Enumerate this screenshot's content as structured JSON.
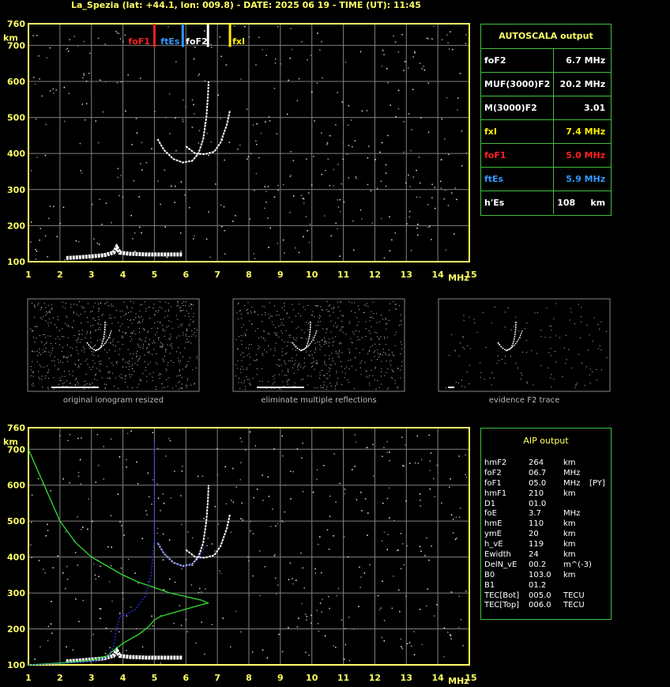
{
  "header": {
    "title": "La_Spezia (lat: +44.1, lon: 009.8) - DATE: 2025 06 19 - TIME (UT): 11:45"
  },
  "colors": {
    "frame": "#ffff66",
    "grid": "#808080",
    "panel_border": "#3fbf3f",
    "foF1": "#ff2020",
    "ftEs": "#3399ff",
    "foF2": "#ffffff",
    "fxI": "#ffee00",
    "profile": "#33dd33",
    "model_trace": "#2233ff"
  },
  "autoscala": {
    "title": "AUTOSCALA output",
    "rows": [
      {
        "label": "foF2",
        "value": "6.7 MHz",
        "color": "#ffffff"
      },
      {
        "label": "MUF(3000)F2",
        "value": "20.2 MHz",
        "color": "#ffffff"
      },
      {
        "label": "M(3000)F2",
        "value": "3.01",
        "color": "#ffffff"
      },
      {
        "label": "fxI",
        "value": "7.4 MHz",
        "color": "#ffee00"
      },
      {
        "label": "foF1",
        "value": "5.0 MHz",
        "color": "#ff2020"
      },
      {
        "label": "ftEs",
        "value": "5.9 MHz",
        "color": "#3399ff"
      },
      {
        "label": "h'Es",
        "value": "108     km",
        "color": "#ffffff"
      }
    ]
  },
  "aip": {
    "title": "AIP output",
    "rows": [
      [
        "hmF2",
        "264",
        "km",
        ""
      ],
      [
        "foF2",
        "06.7",
        "MHz",
        ""
      ],
      [
        "foF1",
        "05.0",
        "MHz",
        "[PY]"
      ],
      [
        "hmF1",
        "210",
        "km",
        ""
      ],
      [
        "D1",
        "01.0",
        "",
        ""
      ],
      [
        "foE",
        "3.7",
        "MHz",
        ""
      ],
      [
        "hmE",
        "110",
        "km",
        ""
      ],
      [
        "ymE",
        "20",
        "km",
        ""
      ],
      [
        "h_vE",
        "119",
        "km",
        ""
      ],
      [
        "Ewidth",
        "24",
        "km",
        ""
      ],
      [
        "DelN_vE",
        "00.2",
        "m^(-3)",
        ""
      ],
      [
        "B0",
        "103.0",
        "km",
        ""
      ],
      [
        "B1",
        "01.2",
        "",
        ""
      ],
      [
        "TEC[Bot]",
        "005.0",
        "TECU",
        ""
      ],
      [
        "TEC[Top]",
        "006.0",
        "TECU",
        ""
      ]
    ]
  },
  "thumbnails": [
    {
      "caption": "original ionogram resized"
    },
    {
      "caption": "eliminate multiple reflections"
    },
    {
      "caption": "evidence F2 trace"
    }
  ],
  "chart_data": [
    {
      "type": "scatter",
      "xlabel": "MHz",
      "ylabel": "km",
      "xlim": [
        1,
        15
      ],
      "ylim": [
        100,
        760
      ],
      "x_ticks": [
        1,
        2,
        3,
        4,
        5,
        6,
        7,
        8,
        9,
        10,
        11,
        12,
        13,
        14,
        15
      ],
      "y_ticks": [
        100,
        200,
        300,
        400,
        500,
        600,
        700,
        760
      ],
      "markers": [
        {
          "name": "foF1",
          "x": 5.0,
          "color": "#ff2020"
        },
        {
          "name": "ftEs",
          "x": 5.9,
          "color": "#3399ff"
        },
        {
          "name": "foF2",
          "x": 6.7,
          "color": "#ffffff"
        },
        {
          "name": "fxI",
          "x": 7.4,
          "color": "#ffee00"
        }
      ],
      "traces": {
        "es_trace": [
          [
            2.2,
            110
          ],
          [
            2.6,
            112
          ],
          [
            3.0,
            115
          ],
          [
            3.4,
            118
          ],
          [
            3.7,
            125
          ],
          [
            3.8,
            140
          ],
          [
            3.9,
            125
          ],
          [
            4.2,
            122
          ],
          [
            4.8,
            120
          ],
          [
            5.4,
            120
          ],
          [
            5.9,
            120
          ]
        ],
        "o_trace": [
          [
            5.1,
            440
          ],
          [
            5.3,
            410
          ],
          [
            5.6,
            385
          ],
          [
            5.9,
            375
          ],
          [
            6.2,
            380
          ],
          [
            6.4,
            400
          ],
          [
            6.55,
            440
          ],
          [
            6.65,
            500
          ],
          [
            6.7,
            560
          ],
          [
            6.72,
            600
          ]
        ],
        "x_trace": [
          [
            6.0,
            420
          ],
          [
            6.3,
            400
          ],
          [
            6.6,
            398
          ],
          [
            6.9,
            405
          ],
          [
            7.1,
            430
          ],
          [
            7.3,
            480
          ],
          [
            7.4,
            520
          ]
        ]
      }
    },
    {
      "type": "line",
      "xlabel": "MHz",
      "ylabel": "km",
      "xlim": [
        1,
        15
      ],
      "ylim": [
        100,
        760
      ],
      "x_ticks": [
        1,
        2,
        3,
        4,
        5,
        6,
        7,
        8,
        9,
        10,
        11,
        12,
        13,
        14,
        15
      ],
      "y_ticks": [
        100,
        200,
        300,
        400,
        500,
        600,
        700,
        760
      ],
      "series": [
        {
          "color": "#33dd33",
          "points": [
            [
              1.0,
              700
            ],
            [
              1.5,
              600
            ],
            [
              2.0,
              500
            ],
            [
              2.5,
              440
            ],
            [
              3.0,
              400
            ],
            [
              3.5,
              375
            ],
            [
              4.0,
              350
            ],
            [
              4.5,
              330
            ],
            [
              5.0,
              315
            ],
            [
              5.5,
              300
            ],
            [
              6.0,
              290
            ],
            [
              6.5,
              280
            ],
            [
              6.7,
              272
            ],
            [
              6.4,
              265
            ],
            [
              5.8,
              250
            ],
            [
              5.2,
              235
            ],
            [
              5.0,
              225
            ],
            [
              4.8,
              205
            ],
            [
              4.5,
              185
            ],
            [
              4.0,
              160
            ],
            [
              3.7,
              140
            ],
            [
              3.5,
              125
            ],
            [
              3.0,
              113
            ],
            [
              2.0,
              105
            ],
            [
              1.0,
              100
            ]
          ]
        },
        {
          "color": "#2233ff",
          "points": [
            [
              1.0,
              100
            ],
            [
              2.0,
              103
            ],
            [
              3.0,
              110
            ],
            [
              3.5,
              120
            ],
            [
              3.7,
              150
            ],
            [
              3.8,
              200
            ],
            [
              3.9,
              235
            ],
            [
              4.1,
              240
            ],
            [
              4.4,
              255
            ],
            [
              4.7,
              290
            ],
            [
              4.9,
              350
            ],
            [
              5.0,
              450
            ],
            [
              5.0,
              720
            ]
          ]
        },
        {
          "color": "#2233ff",
          "points": [
            [
              5.1,
              440
            ],
            [
              5.3,
              410
            ],
            [
              5.6,
              385
            ],
            [
              5.9,
              375
            ],
            [
              6.2,
              380
            ],
            [
              6.4,
              395
            ],
            [
              6.6,
              430
            ]
          ]
        }
      ],
      "traces": {
        "es_trace": [
          [
            2.2,
            110
          ],
          [
            2.6,
            112
          ],
          [
            3.0,
            115
          ],
          [
            3.4,
            118
          ],
          [
            3.7,
            125
          ],
          [
            3.8,
            140
          ],
          [
            3.9,
            125
          ],
          [
            4.2,
            122
          ],
          [
            4.8,
            120
          ],
          [
            5.4,
            120
          ],
          [
            5.9,
            120
          ]
        ],
        "o_trace": [
          [
            5.1,
            440
          ],
          [
            5.3,
            410
          ],
          [
            5.6,
            385
          ],
          [
            5.9,
            375
          ],
          [
            6.2,
            380
          ],
          [
            6.4,
            400
          ],
          [
            6.55,
            440
          ],
          [
            6.65,
            500
          ],
          [
            6.7,
            560
          ],
          [
            6.72,
            600
          ]
        ],
        "x_trace": [
          [
            6.0,
            420
          ],
          [
            6.3,
            400
          ],
          [
            6.6,
            398
          ],
          [
            6.9,
            405
          ],
          [
            7.1,
            430
          ],
          [
            7.3,
            480
          ],
          [
            7.4,
            520
          ]
        ]
      }
    }
  ]
}
